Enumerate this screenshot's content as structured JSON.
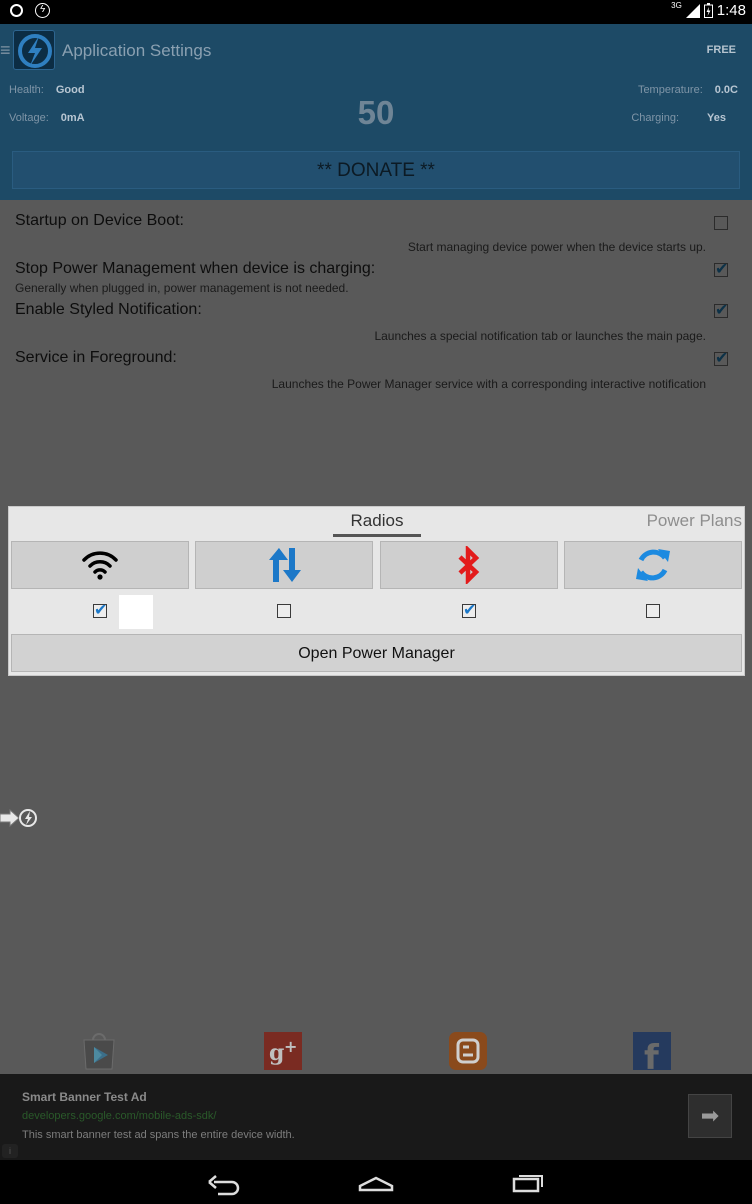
{
  "status_bar": {
    "network": "3G",
    "time": "1:48"
  },
  "header": {
    "menu_icon": "hamburger-icon",
    "title": "Application Settings",
    "badge": "FREE",
    "health_label": "Health:",
    "health_value": "Good",
    "voltage_label": "Voltage:",
    "voltage_value": "0mA",
    "battery_percent": "50",
    "temperature_label": "Temperature:",
    "temperature_value": "0.0C",
    "charging_label": "Charging:",
    "charging_value": "Yes",
    "donate_label": "** DONATE **"
  },
  "settings": [
    {
      "title": "Startup on Device Boot:",
      "description": "Start managing device power when the device starts up.",
      "checked": false
    },
    {
      "title": "Stop Power Management when device is charging:",
      "description": "Generally when plugged in, power management is not needed.",
      "checked": true
    },
    {
      "title": "Enable Styled Notification:",
      "description": "Launches a special notification tab or launches the main page.",
      "checked": true
    },
    {
      "title": "Service in Foreground:",
      "description": "Launches the Power Manager service with a corresponding interactive notification",
      "checked": true
    }
  ],
  "widget": {
    "tabs": [
      {
        "label": "Radios",
        "active": true
      },
      {
        "label": "Power Plans",
        "active": false
      }
    ],
    "radios": [
      {
        "icon": "wifi-icon",
        "checked": true
      },
      {
        "icon": "mobile-data-icon",
        "checked": false
      },
      {
        "icon": "bluetooth-icon",
        "checked": true
      },
      {
        "icon": "sync-icon",
        "checked": false
      }
    ],
    "open_button": "Open Power Manager"
  },
  "social": [
    {
      "icon": "play-store-icon"
    },
    {
      "icon": "google-plus-icon"
    },
    {
      "icon": "blogger-icon"
    },
    {
      "icon": "facebook-icon"
    }
  ],
  "ad": {
    "title": "Smart Banner Test Ad",
    "url": "developers.google.com/mobile-ads-sdk/",
    "description": "This smart banner test ad spans the entire device width."
  },
  "colors": {
    "accent": "#1d4a66",
    "wifi": "#000000",
    "data": "#1c78c8",
    "bluetooth": "#e31b1b",
    "sync": "#1c8ae0"
  }
}
